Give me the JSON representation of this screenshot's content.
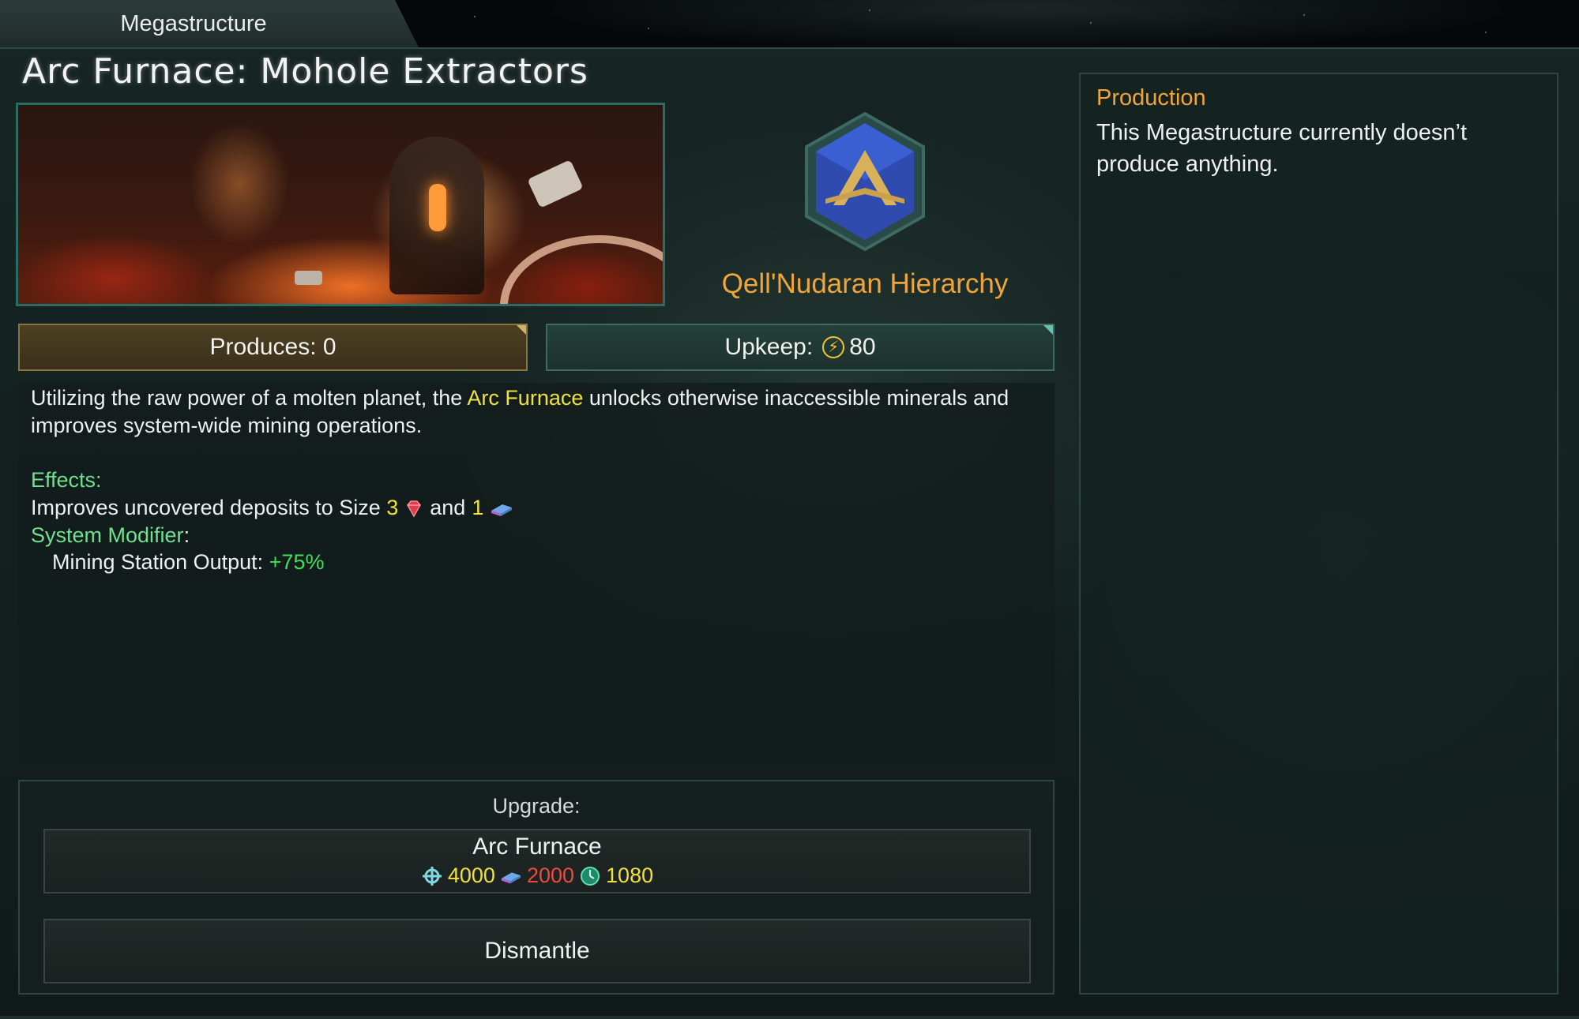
{
  "tab": {
    "label": "Megastructure"
  },
  "title": "Arc Furnace: Mohole Extractors",
  "empire": {
    "name": "Qell'Nudaran Hierarchy",
    "emblem_icon": "hierarchy-emblem-icon"
  },
  "stats": {
    "produces_label": "Produces: 0",
    "upkeep_label": "Upkeep:",
    "upkeep_icon": "energy-icon",
    "upkeep_value": "80"
  },
  "description": {
    "text_before": "Utilizing the raw power of a molten planet, the ",
    "highlight": "Arc Furnace",
    "text_after": " unlocks otherwise inaccessible minerals and improves system-wide mining operations.",
    "effects_label": "Effects:",
    "effect_line_prefix": "Improves uncovered deposits to Size ",
    "effect_size_gem": "3",
    "effect_and": "and",
    "effect_size_alloy": "1",
    "system_modifier_label": "System Modifier",
    "system_modifier_colon": ":",
    "mining_label": "Mining Station Output: ",
    "mining_value": "+75%"
  },
  "upgrade": {
    "label": "Upgrade:",
    "name": "Arc Furnace",
    "costs": [
      {
        "icon": "influence-icon",
        "value": "4000",
        "color": "#f0e23a"
      },
      {
        "icon": "alloys-icon",
        "value": "2000",
        "color": "#f04a3a"
      },
      {
        "icon": "time-icon",
        "value": "1080",
        "color": "#f0e23a"
      }
    ]
  },
  "dismantle": {
    "label": "Dismantle"
  },
  "production": {
    "title": "Production",
    "text": "This Megastructure currently doesn’t produce anything."
  },
  "colors": {
    "accent_orange": "#f0a53a",
    "effect_green": "#6fe08f",
    "highlight_yellow": "#f0e23a"
  }
}
